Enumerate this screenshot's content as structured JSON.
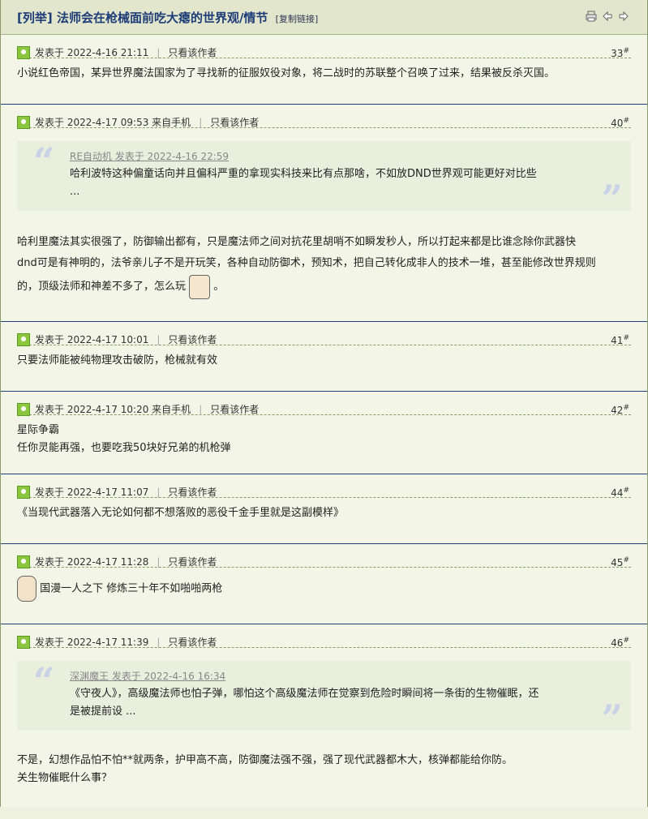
{
  "thread": {
    "category": "[列举]",
    "title": "法师会在枪械面前吃大瘪的世界观/情节",
    "copy_link": "[复制链接]"
  },
  "icons": [
    "print-icon",
    "prev-arrow-icon",
    "next-arrow-icon"
  ],
  "labels": {
    "only_author": "只看该作者",
    "posted_prefix": "发表于",
    "mobile": "来自手机"
  },
  "posts": [
    {
      "time": "2022-4-16 21:11",
      "mobile": false,
      "floor": "33",
      "body": [
        "小说红色帝国，某异世界魔法国家为了寻找新的征服奴役对象，将二战时的苏联整个召唤了过来，结果被反杀灭国。"
      ]
    },
    {
      "time": "2022-4-17 09:53",
      "mobile": true,
      "floor": "40",
      "quote": {
        "author": "RE自动机",
        "posted": "发表于 2022-4-16 22:59",
        "text": "哈利波特这种偏童话向并且偏科严重的拿现实科技来比有点那啥，不如放DND世界观可能更好对比些",
        "more": "..."
      },
      "body": [
        "哈利里魔法其实很强了，防御输出都有，只是魔法师之间对抗花里胡哨不如瞬发秒人，所以打起来都是比谁念除你武器快",
        "dnd可是有神明的，法爷亲儿子不是开玩笑，各种自动防御术，预知术，把自己转化成非人的技术一堆，甚至能修改世界规则",
        "的，顶级法师和神差不多了，怎么玩",
        "。"
      ]
    },
    {
      "time": "2022-4-17 10:01",
      "mobile": false,
      "floor": "41",
      "body": [
        "只要法师能被纯物理攻击破防，枪械就有效"
      ]
    },
    {
      "time": "2022-4-17 10:20",
      "mobile": true,
      "floor": "42",
      "body": [
        "星际争霸",
        "任你灵能再强，也要吃我50块好兄弟的机枪弹"
      ]
    },
    {
      "time": "2022-4-17 11:07",
      "mobile": false,
      "floor": "44",
      "body": [
        "《当现代武器落入无论如何都不想落败的恶役千金手里就是这副模样》"
      ]
    },
    {
      "time": "2022-4-17 11:28",
      "mobile": false,
      "floor": "45",
      "body": [
        "国漫一人之下 修炼三十年不如啪啪两枪"
      ]
    },
    {
      "time": "2022-4-17 11:39",
      "mobile": false,
      "floor": "46",
      "quote": {
        "author": "深渊魔王",
        "posted": "发表于 2022-4-16 16:34",
        "text": "《守夜人》，高级魔法师也怕子弹，哪怕这个高级魔法师在觉察到危险时瞬间将一条街的生物催眠，还",
        "text2": "是被提前设 ..."
      },
      "body": [
        "不是，幻想作品怕不怕**就两条，护甲高不高，防御魔法强不强，强了现代武器都木大，核弹都能给你防。",
        "关生物催眠什么事？"
      ]
    }
  ]
}
